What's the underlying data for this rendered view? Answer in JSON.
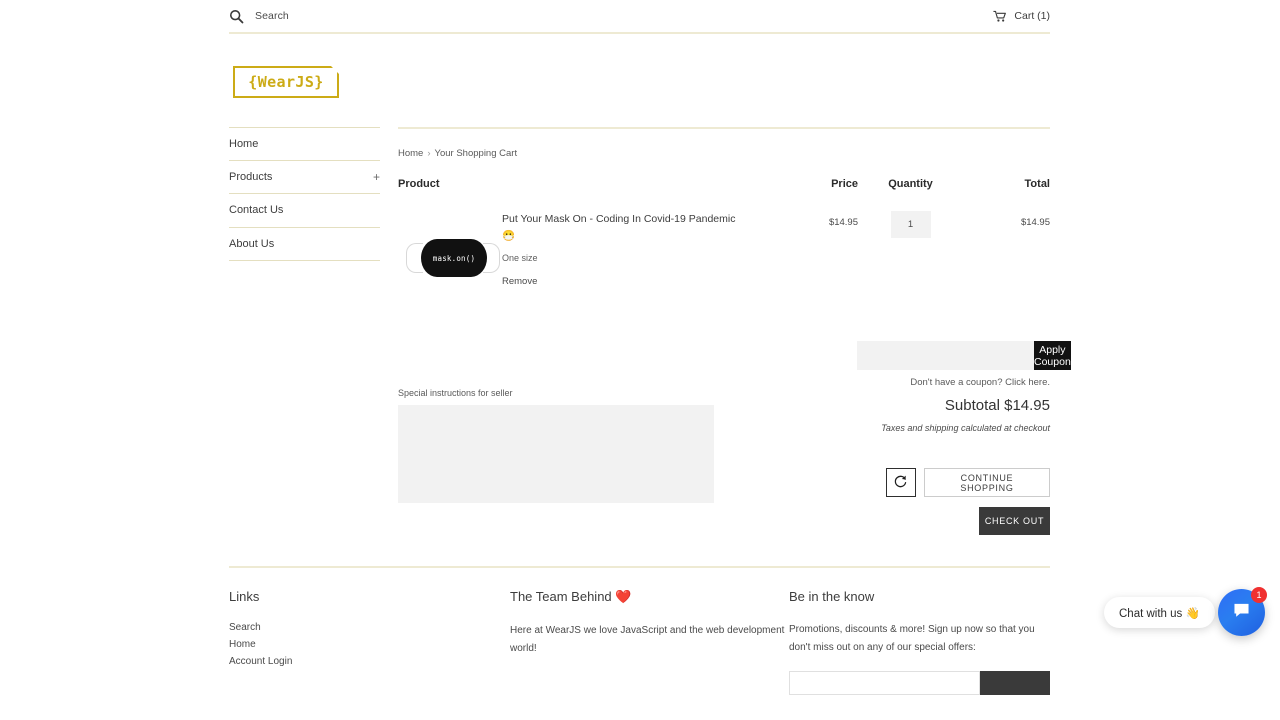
{
  "topbar": {
    "search_placeholder": "Search",
    "search_icon": "search-icon",
    "cart_icon": "cart-icon",
    "cart_label": "Cart (1)"
  },
  "brand": {
    "logo_text": "{WearJS}",
    "accent_color": "#ccab16"
  },
  "sidebar": {
    "items": [
      {
        "label": "Home",
        "expander": ""
      },
      {
        "label": "Products",
        "expander": "+"
      },
      {
        "label": "Contact Us",
        "expander": ""
      },
      {
        "label": "About Us",
        "expander": ""
      }
    ]
  },
  "breadcrumb": {
    "home": "Home",
    "separator": "›",
    "current": "Your Shopping Cart"
  },
  "cart": {
    "headers": {
      "product": "Product",
      "price": "Price",
      "quantity": "Quantity",
      "total": "Total"
    },
    "items": [
      {
        "thumb_text": "mask.on()",
        "title": "Put Your Mask On - Coding In Covid-19 Pandemic 😷",
        "variant": "One size",
        "remove_label": "Remove",
        "price": "$14.95",
        "quantity": "1",
        "total": "$14.95"
      }
    ]
  },
  "notes": {
    "label": "Special instructions for seller",
    "value": ""
  },
  "totals": {
    "coupon_value": "",
    "apply_coupon_label": "Apply Coupon",
    "coupon_hint": "Don't have a coupon? Click here.",
    "subtotal_label": "Subtotal",
    "subtotal_value": "$14.95",
    "tax_note": "Taxes and shipping calculated at checkout"
  },
  "actions": {
    "refresh_icon": "refresh-icon",
    "continue_label": "CONTINUE SHOPPING",
    "checkout_label": "CHECK OUT"
  },
  "footer": {
    "links": {
      "heading": "Links",
      "items": [
        "Search",
        "Home",
        "Account Login"
      ]
    },
    "team": {
      "heading": "The Team Behind ❤️",
      "text": "Here at WearJS we love JavaScript and the web development world!"
    },
    "newsletter": {
      "heading": "Be in the know",
      "text": "Promotions, discounts & more! Sign up now so that you don't miss out on any of our special offers:",
      "email_value": ""
    }
  },
  "chat": {
    "pill_label": "Chat with us 👋",
    "fab_icon": "chat-bubble-icon",
    "badge_count": "1"
  }
}
